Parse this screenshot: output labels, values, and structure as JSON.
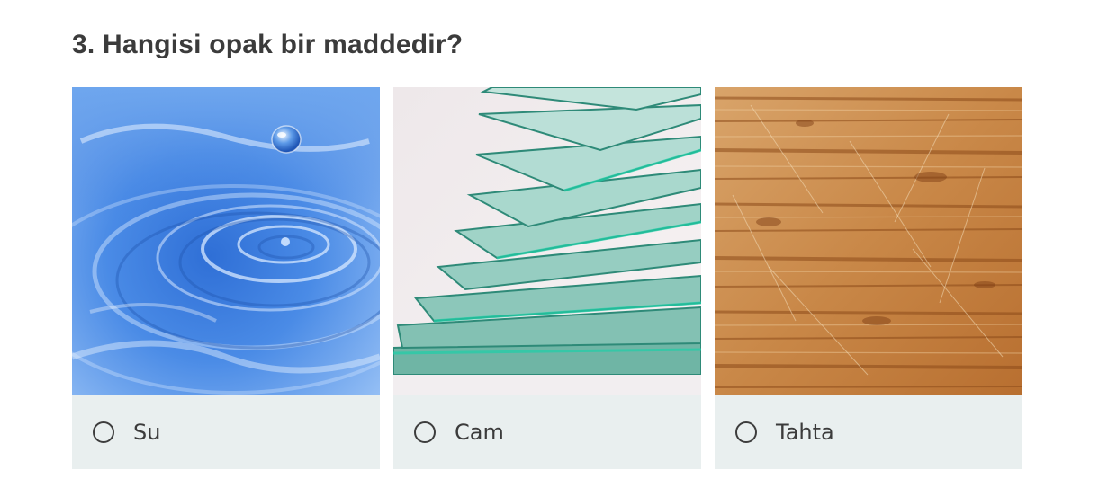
{
  "question": {
    "title": "3. Hangisi opak bir maddedir?"
  },
  "options": [
    {
      "label": "Su",
      "image": "water-drop-image",
      "selected": false
    },
    {
      "label": "Cam",
      "image": "glass-sheets-image",
      "selected": false
    },
    {
      "label": "Tahta",
      "image": "wood-board-image",
      "selected": false
    }
  ],
  "colors": {
    "title": "#3b3b3b",
    "option_footer_bg": "#e9efef",
    "radio_border": "#3d3d3d"
  }
}
